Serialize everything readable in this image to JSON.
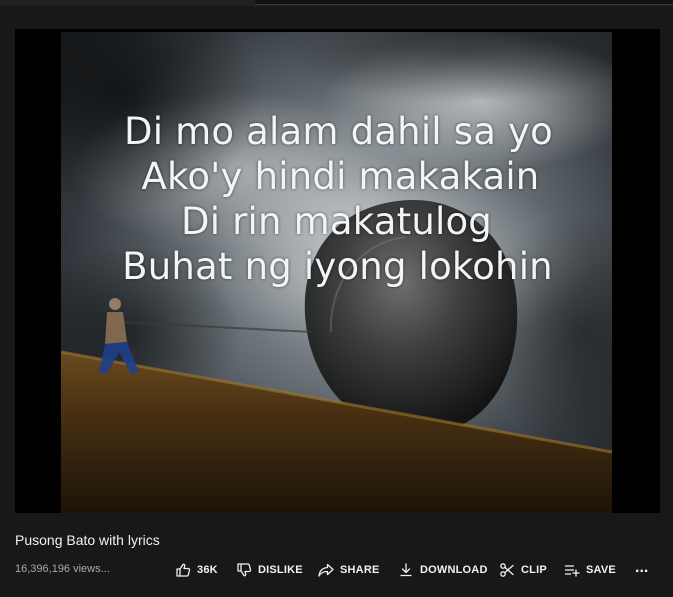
{
  "video": {
    "lyrics": [
      "Di mo alam dahil sa yo",
      "Ako'y hindi makakain",
      "Di rin makatulog",
      "Buhat ng iyong lokohin"
    ]
  },
  "meta": {
    "title": "Pusong Bato with lyrics",
    "views": "16,396,196 views..."
  },
  "actions": {
    "like_count": "36K",
    "dislike_label": "DISLIKE",
    "share_label": "SHARE",
    "download_label": "DOWNLOAD",
    "clip_label": "CLIP",
    "save_label": "SAVE",
    "more_label": "..."
  },
  "icons": {
    "like": "thumbs-up-icon",
    "dislike": "thumbs-down-icon",
    "share": "share-arrow-icon",
    "download": "download-icon",
    "clip": "scissors-icon",
    "save": "playlist-add-icon"
  },
  "colors": {
    "background": "#181818",
    "text_primary": "#f1f1f1",
    "text_secondary": "#aaaaaa",
    "player_bg": "#000000"
  }
}
